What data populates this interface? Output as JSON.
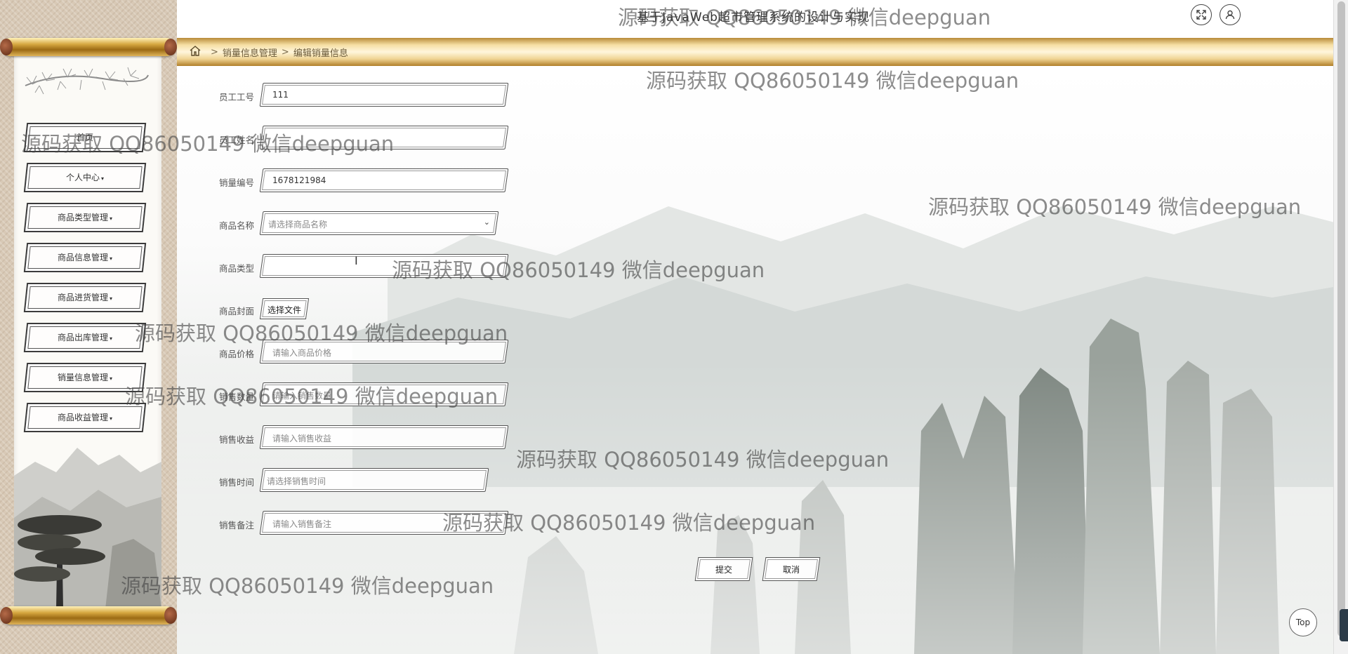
{
  "header": {
    "title": "基于JavaWeb超市管理系统的设计与实现",
    "icons": [
      "fullscreen-icon",
      "user-icon"
    ]
  },
  "breadcrumb": {
    "home_icon": "home-icon",
    "separator": ">",
    "items": [
      "销量信息管理",
      "编辑销量信息"
    ]
  },
  "sidebar": {
    "items": [
      {
        "label": "首页",
        "has_caret": false
      },
      {
        "label": "个人中心",
        "has_caret": true
      },
      {
        "label": "商品类型管理",
        "has_caret": true
      },
      {
        "label": "商品信息管理",
        "has_caret": true
      },
      {
        "label": "商品进货管理",
        "has_caret": true
      },
      {
        "label": "商品出库管理",
        "has_caret": true
      },
      {
        "label": "销量信息管理",
        "has_caret": true
      },
      {
        "label": "商品收益管理",
        "has_caret": true
      }
    ],
    "caret": "▾"
  },
  "form": {
    "fields": [
      {
        "label": "员工工号",
        "value": "111",
        "placeholder": ""
      },
      {
        "label": "员工姓名",
        "value": "",
        "placeholder": ""
      },
      {
        "label": "销量编号",
        "value": "1678121984",
        "placeholder": ""
      },
      {
        "label": "商品名称",
        "value": "",
        "placeholder": "请选择商品名称",
        "type": "select"
      },
      {
        "label": "商品类型",
        "value": "",
        "placeholder": ""
      },
      {
        "label": "商品封面",
        "type": "file",
        "button_label": "选择文件"
      },
      {
        "label": "商品价格",
        "value": "",
        "placeholder": "请输入商品价格"
      },
      {
        "label": "销售数量",
        "value": "",
        "placeholder": "请输入销售数量"
      },
      {
        "label": "销售收益",
        "value": "",
        "placeholder": "请输入销售收益"
      },
      {
        "label": "销售时间",
        "value": "",
        "placeholder": "请选择销售时间",
        "type": "date"
      },
      {
        "label": "销售备注",
        "value": "",
        "placeholder": "请输入销售备注"
      }
    ],
    "submit_label": "提交",
    "cancel_label": "取消"
  },
  "watermark_text": "源码获取 QQ86050149 微信deepguan",
  "back_to_top_label": "Top",
  "colors": {
    "gold_bar": "#d9b262",
    "accent_dark": "#333333",
    "scroll_rod": "#c8962e"
  }
}
